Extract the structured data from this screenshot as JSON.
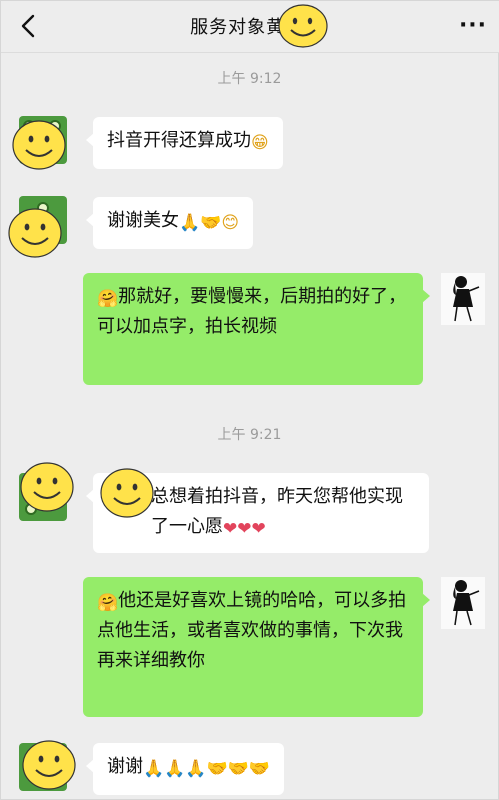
{
  "header": {
    "title": "服务对象黄 妮",
    "back_icon": "chevron-left-icon",
    "more_label": "···"
  },
  "messages": [
    {
      "type": "time",
      "text": "上午 9:12"
    },
    {
      "type": "in",
      "text": "抖音开得还算成功",
      "emoji": "😁"
    },
    {
      "type": "in",
      "text": "谢谢美女",
      "emoji": "🙏🤝😊"
    },
    {
      "type": "out",
      "prefix_emoji": "🤗",
      "text": "那就好，要慢慢来，后期拍的好了，可以加点字，拍长视频"
    },
    {
      "type": "time",
      "text": "上午 9:21"
    },
    {
      "type": "in",
      "text": "总想着拍抖音，昨天您帮他实现了一心愿",
      "emoji": "❤❤❤"
    },
    {
      "type": "out",
      "prefix_emoji": "🤗",
      "text": "他还是好喜欢上镜的哈哈，可以多拍点他生活，或者喜欢做的事情，下次我再来详细教你"
    },
    {
      "type": "in",
      "text": "谢谢",
      "emoji": "🙏🙏🙏🤝🤝🤝"
    }
  ],
  "colors": {
    "background": "#ededed",
    "incoming_bubble": "#ffffff",
    "outgoing_bubble": "#95ec69",
    "timestamp": "#9b9b9b",
    "avatar_green": "#4c9a3e",
    "smiley_yellow": "#ffe24a"
  }
}
